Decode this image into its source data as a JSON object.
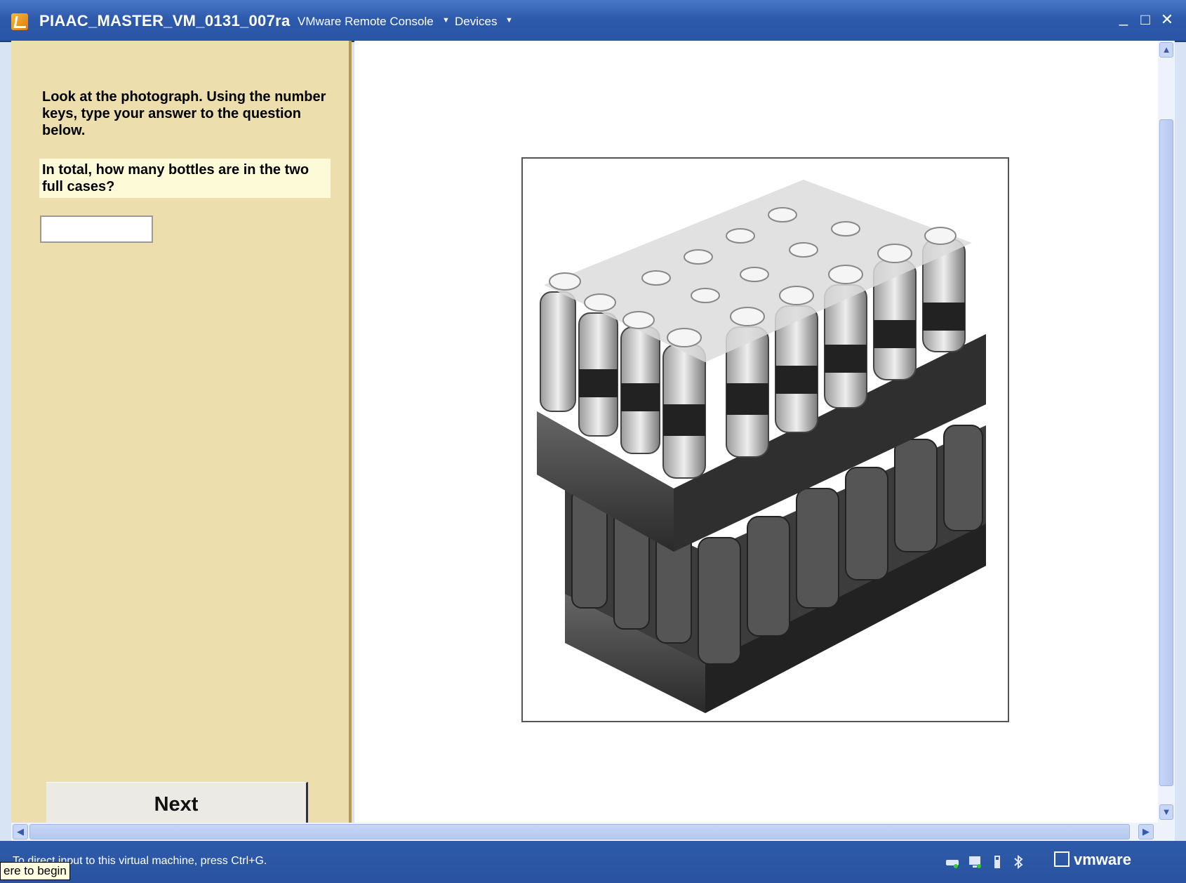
{
  "window": {
    "title": "PIAAC_MASTER_VM_0131_007ra",
    "menu": [
      "VMware Remote Console",
      "Devices"
    ],
    "controls": {
      "minimize": "_",
      "maximize": "□",
      "close": "✕"
    }
  },
  "task": {
    "instruction": "Look at the photograph.  Using the number keys, type your answer to the question below.",
    "question": "In total, how many bottles are in the two full cases?",
    "answer_value": "",
    "next_label": "Next"
  },
  "photo": {
    "icon": "photo-water-bottle-cases"
  },
  "statusbar": {
    "text": "To direct input to this virtual machine, press Ctrl+G.",
    "tooltip": "ere to begin",
    "brand": "vmware"
  },
  "colors": {
    "titlebar": "#2e5aac",
    "panel": "#ecdfad",
    "question_bg": "#fdfad8"
  }
}
